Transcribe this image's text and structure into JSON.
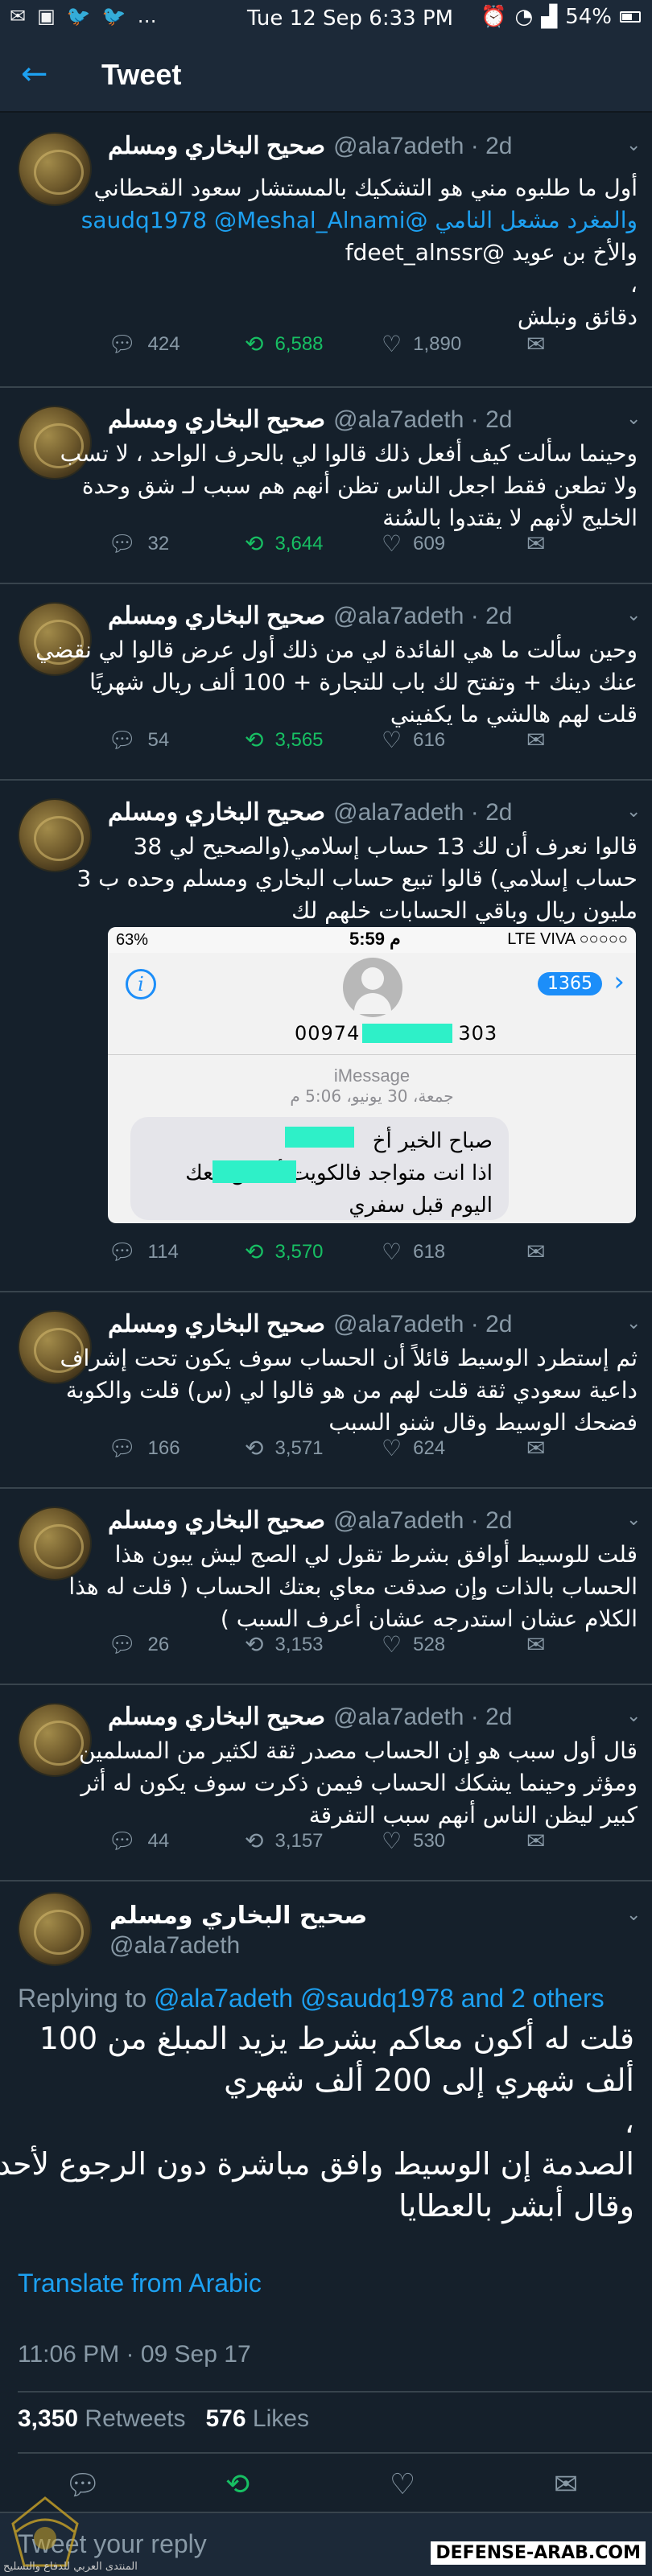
{
  "status_bar": {
    "left_icons": [
      "✉",
      "▣",
      "🐦",
      "🐦",
      "…"
    ],
    "time": "Tue 12 Sep 6:33 PM",
    "battery": "54%"
  },
  "app_bar": {
    "back_icon": "←",
    "title": "Tweet"
  },
  "tweets": [
    {
      "name": "صحيح البخاري ومسلم",
      "meta": "@ala7adeth · 2d",
      "lines": [
        {
          "text": "أول ما طلبوه مني هو التشكيك بالمستشار سعود القحطاني"
        },
        {
          "text": "والمغرد مشعل النامي @saudq1978 @Meshal_Alnami"
        },
        {
          "text": "والأخ بن عويد @fdeet_alnssr"
        },
        {
          "text": "،"
        },
        {
          "text": "دقائق ونبلش"
        }
      ],
      "replies": "424",
      "retweets": "6,588",
      "likes": "1,890"
    },
    {
      "name": "صحيح البخاري ومسلم",
      "meta": "@ala7adeth · 2d",
      "lines": [
        {
          "text": "وحينما سألت كيف أفعل ذلك قالوا لي بالحرف الواحد ، لا تسب"
        },
        {
          "text": "ولا تطعن فقط اجعل الناس تظن أنهم هم سبب لـ شق وحدة"
        },
        {
          "text": "الخليج لأنهم لا يقتدوا بالسُنة"
        }
      ],
      "replies": "32",
      "retweets": "3,644",
      "likes": "609"
    },
    {
      "name": "صحيح البخاري ومسلم",
      "meta": "@ala7adeth · 2d",
      "lines": [
        {
          "text": "وحين سألت ما هي الفائدة لي من ذلك أول عرض قالوا لي نقضي"
        },
        {
          "text": "عنك دينك + وتفتح لك باب للتجارة + 100 ألف ريال شهريًا"
        },
        {
          "text": "قلت لهم هالشي ما يكفيني"
        }
      ],
      "replies": "54",
      "retweets": "3,565",
      "likes": "616"
    },
    {
      "name": "صحيح البخاري ومسلم",
      "meta": "@ala7adeth · 2d",
      "lines": [
        {
          "text": "قالوا نعرف أن لك 13 حساب إسلامي(والصحيح لي 38"
        },
        {
          "text": "حساب إسلامي) قالوا تبيع حساب البخاري ومسلم وحده ب 3"
        },
        {
          "text": "مليون ريال وباقي الحسابات خلهم لك"
        }
      ],
      "embed": {
        "status_left": "63%",
        "clock": "5:59 م",
        "status_right": "LTE VIVA ○○○○○",
        "info_icon": "i",
        "count": "1365",
        "phone_prefix": "00974",
        "phone_suffix": "303",
        "service": "iMessage",
        "date": "جمعة، 30 يونيو، 5:06 م",
        "bubble_lines": [
          "صباح الخير أخ",
          "اذا انت متواجد فالكويت أجلس معك",
          "اليوم قبل سفري"
        ]
      },
      "replies": "114",
      "retweets": "3,570",
      "likes": "618"
    },
    {
      "name": "صحيح البخاري ومسلم",
      "meta": "@ala7adeth · 2d",
      "lines": [
        {
          "text": "ثم إستطرد الوسيط قائلاً أن الحساب سوف يكون تحت إشراف"
        },
        {
          "text": "داعية سعودي ثقة قلت لهم من هو قالوا لي (س) قلت والكوبة"
        },
        {
          "text": "فضحك الوسيط وقال شنو السبب"
        }
      ],
      "replies": "166",
      "retweets": "3,571",
      "likes": "624"
    },
    {
      "name": "صحيح البخاري ومسلم",
      "meta": "@ala7adeth · 2d",
      "lines": [
        {
          "text": "قلت للوسيط أوافق بشرط تقول لي الصج ليش يبون هذا"
        },
        {
          "text": "الحساب بالذات وإن صدقت معاي بعتك الحساب ( قلت له هذا"
        },
        {
          "text": "الكلام عشان استدرجه عشان أعرف السبب )"
        }
      ],
      "replies": "26",
      "retweets": "3,153",
      "likes": "528"
    },
    {
      "name": "صحيح البخاري ومسلم",
      "meta": "@ala7adeth · 2d",
      "lines": [
        {
          "text": "قال أول سبب هو إن الحساب مصدر ثقة لكثير من المسلمين"
        },
        {
          "text": "ومؤثر وحينما يشكك الحساب فيمن ذكرت سوف يكون له أثر"
        },
        {
          "text": "كبير ليظن الناس أنهم سبب التفرقة"
        }
      ],
      "replies": "44",
      "retweets": "3,157",
      "likes": "530"
    }
  ],
  "main_tweet": {
    "name": "صحيح البخاري ومسلم",
    "handle": "@ala7adeth",
    "replying_label": "Replying to",
    "replying_to": "@ala7adeth @saudq1978 and 2 others",
    "lines": [
      "قلت له أكون معاكم بشرط يزيد المبلغ من 100",
      "ألف شهري إلى 200 ألف شهري",
      "،",
      "الصدمة إن الوسيط وافق مباشرة دون الرجوع لأحد",
      "وقال أبشر بالعطايا"
    ],
    "translate": "Translate from Arabic",
    "timestamp": "11:06 PM · 09 Sep 17",
    "retweets_count": "3,350",
    "retweets_label": "Retweets",
    "likes_count": "576",
    "likes_label": "Likes"
  },
  "reply_bar": {
    "placeholder": "Tweet your reply"
  },
  "watermark": {
    "text": "DEFENSE-ARAB.COM",
    "sub": "المنتدى العربي للدفاع والتسليح"
  },
  "colors": {
    "bg": "#15202b",
    "bar": "#1c2938",
    "accent": "#1da1f2",
    "retweet_active": "#17bf63",
    "muted": "#8899a6"
  },
  "icons": {
    "reply": "reply-icon",
    "retweet": "retweet-icon",
    "like": "heart-icon",
    "share": "mail-icon",
    "chevron": "chevron-down-icon"
  }
}
